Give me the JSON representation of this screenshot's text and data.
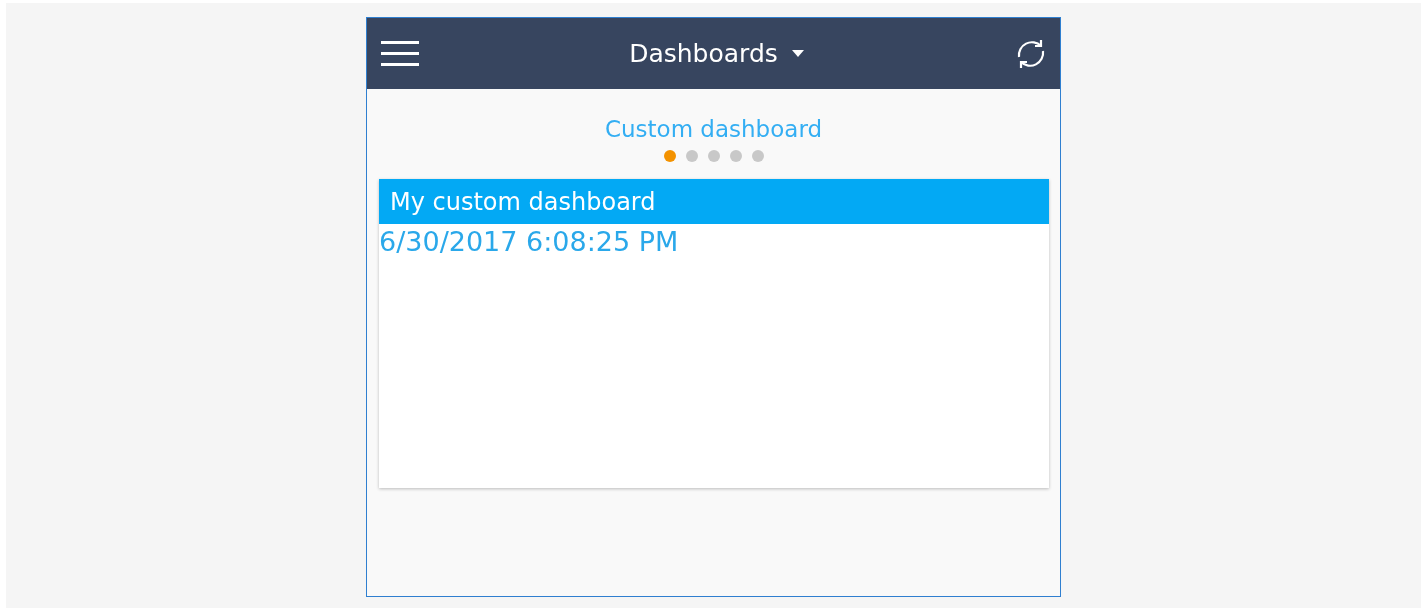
{
  "header": {
    "title": "Dashboards"
  },
  "page_title": "Custom dashboard",
  "pager": [
    {
      "selected": true
    },
    {
      "selected": false
    },
    {
      "selected": false
    },
    {
      "selected": false
    },
    {
      "selected": false
    }
  ],
  "widget": {
    "title": "My custom dashboard",
    "value": "6/30/2017 6:08:25 PM"
  }
}
